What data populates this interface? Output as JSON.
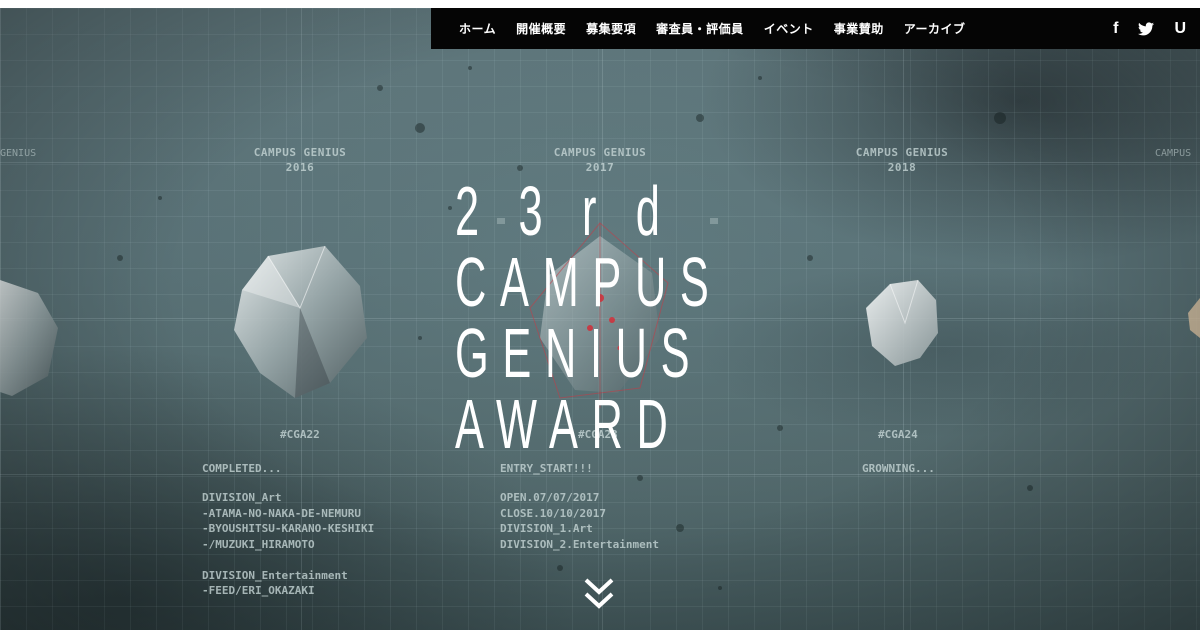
{
  "nav": {
    "items": [
      {
        "label": "ホーム"
      },
      {
        "label": "開催概要"
      },
      {
        "label": "募集要項"
      },
      {
        "label": "審査員・評価員"
      },
      {
        "label": "イベント"
      },
      {
        "label": "事業賛助"
      },
      {
        "label": "アーカイブ"
      }
    ],
    "social": {
      "facebook": "f",
      "twitter": "🐦",
      "ustream": "U"
    }
  },
  "hero": {
    "title_lines": [
      "2 3 r d",
      "CAMPUS",
      "GENIUS",
      "AWARD"
    ],
    "columns": [
      {
        "name": "CAMPUS GENIUS",
        "year": "2016",
        "tag": "#CGA22",
        "status": "COMPLETED...",
        "details": "DIVISION_Art\n-ATAMA-NO-NAKA-DE-NEMURU\n-BYOUSHITSU-KARANO-KESHIKI\n-/MUZUKI_HIRAMOTO\n\nDIVISION_Entertainment\n-FEED/ERI_OKAZAKI"
      },
      {
        "name": "CAMPUS GENIUS",
        "year": "2017",
        "tag": "#CGA23",
        "status": "ENTRY_START!!!",
        "details": "OPEN.07/07/2017\nCLOSE.10/10/2017\nDIVISION_1.Art\nDIVISION_2.Entertainment"
      },
      {
        "name": "CAMPUS GENIUS",
        "year": "2018",
        "tag": "#CGA24",
        "status": "GROWNING...",
        "details": ""
      }
    ],
    "edge_left": "GENIUS",
    "edge_right": "CAMPUS"
  },
  "colors": {
    "nav_bg": "#050505",
    "title": "#ffffff",
    "accent_red": "#d8323c"
  }
}
